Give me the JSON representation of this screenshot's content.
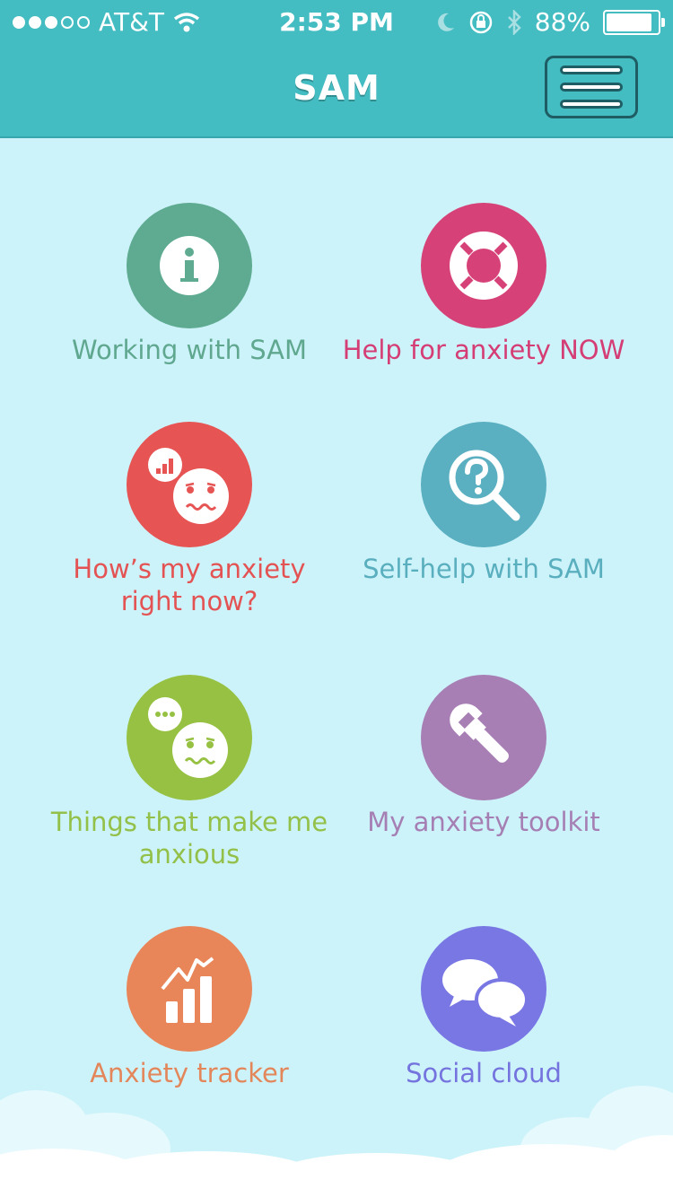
{
  "status_bar": {
    "carrier": "AT&T",
    "time": "2:53 PM",
    "battery": "88%"
  },
  "header": {
    "title": "SAM"
  },
  "tiles": [
    {
      "label": "Working with SAM",
      "color": "#5fab91",
      "text_color": "#5fa88f",
      "icon": "info-icon"
    },
    {
      "label": "Help for anxiety NOW",
      "color": "#d64277",
      "text_color": "#d43e75",
      "icon": "lifebuoy-icon"
    },
    {
      "label": "How’s my anxiety right now?",
      "color": "#e65454",
      "text_color": "#e45353",
      "icon": "anxious-face-rating-icon"
    },
    {
      "label": "Self-help with SAM",
      "color": "#5aafc0",
      "text_color": "#5aafbf",
      "icon": "magnifier-question-icon"
    },
    {
      "label": "Things that make me anxious",
      "color": "#97c143",
      "text_color": "#93c049",
      "icon": "anxious-face-thought-icon"
    },
    {
      "label": "My anxiety toolkit",
      "color": "#a77fb4",
      "text_color": "#a57fb3",
      "icon": "wrench-icon"
    },
    {
      "label": "Anxiety tracker",
      "color": "#e8865a",
      "text_color": "#e3865a",
      "icon": "bar-chart-icon"
    },
    {
      "label": "Social cloud",
      "color": "#7877e3",
      "text_color": "#7574df",
      "icon": "speech-bubbles-icon"
    }
  ]
}
